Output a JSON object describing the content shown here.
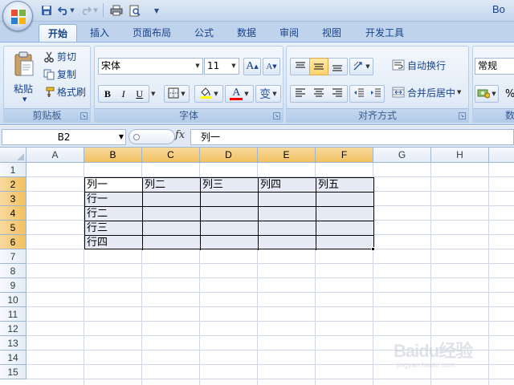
{
  "app": {
    "title": "Bo"
  },
  "quick_access": {
    "save_icon": "save-icon",
    "undo_icon": "undo-icon",
    "redo_icon": "redo-icon",
    "print_icon": "print-icon",
    "preview_icon": "print-preview-icon",
    "customize_icon": "customize-arrow-icon"
  },
  "tabs": [
    {
      "label": "开始",
      "active": true
    },
    {
      "label": "插入"
    },
    {
      "label": "页面布局"
    },
    {
      "label": "公式"
    },
    {
      "label": "数据"
    },
    {
      "label": "审阅"
    },
    {
      "label": "视图"
    },
    {
      "label": "开发工具"
    }
  ],
  "clipboard": {
    "group_label": "剪贴板",
    "paste_label": "粘贴",
    "cut_label": "剪切",
    "copy_label": "复制",
    "format_painter_label": "格式刷"
  },
  "font": {
    "group_label": "字体",
    "font_name": "宋体",
    "font_size": "11",
    "bold": "B",
    "italic": "I",
    "underline": "U",
    "grow": "A",
    "shrink": "A",
    "font_color_letter": "A",
    "phonetic": "变",
    "fill_color": "#ffff00",
    "font_color": "#ff0000"
  },
  "alignment": {
    "group_label": "对齐方式",
    "wrap_text_label": "自动换行",
    "merge_center_label": "合并后居中"
  },
  "number": {
    "group_label": "数",
    "format": "常规",
    "percent": "%"
  },
  "formula_bar": {
    "name_box": "B2",
    "fx": "fx",
    "content": "列一"
  },
  "sheet": {
    "columns": [
      "A",
      "B",
      "C",
      "D",
      "E",
      "F",
      "G",
      "H"
    ],
    "rows": [
      "1",
      "2",
      "3",
      "4",
      "5",
      "6",
      "7",
      "8",
      "9",
      "10",
      "11",
      "12",
      "13",
      "14",
      "15"
    ],
    "selected_columns": [
      "B",
      "C",
      "D",
      "E",
      "F"
    ],
    "selected_rows": [
      "2",
      "3",
      "4",
      "5",
      "6"
    ],
    "table": {
      "header": [
        "列一",
        "列二",
        "列三",
        "列四",
        "列五"
      ],
      "row_labels": [
        "行一",
        "行二",
        "行三",
        "行四"
      ]
    }
  },
  "watermark": {
    "text": "Baidu经验",
    "sub": "jingyan.baidu.com"
  }
}
